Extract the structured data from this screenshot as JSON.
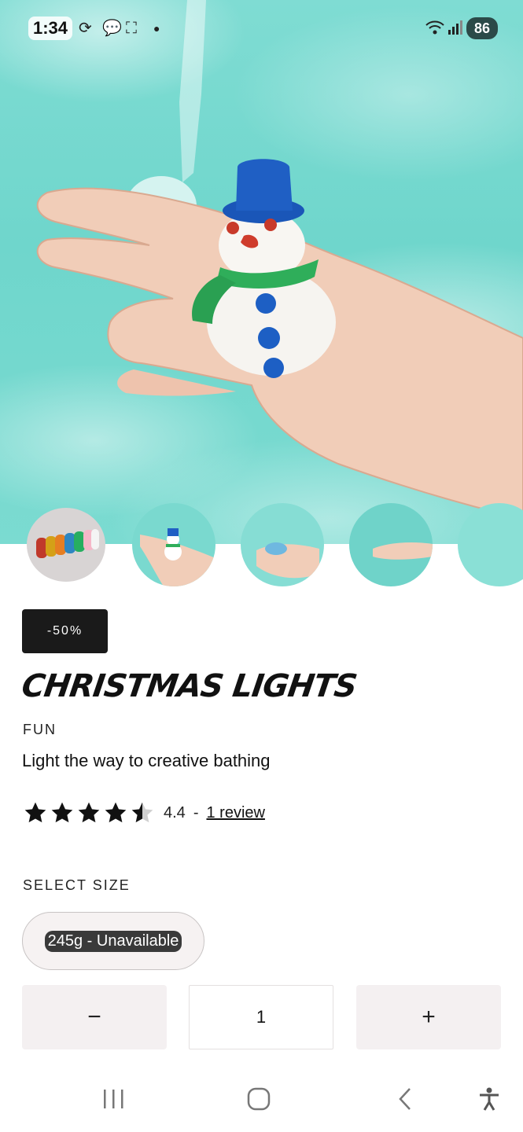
{
  "status_bar": {
    "time": "1:34",
    "battery": "86",
    "icons": [
      "sync-icon",
      "chat-icon",
      "screenshot-icon",
      "dot-icon",
      "wifi-icon",
      "signal-icon"
    ]
  },
  "hero": {
    "image": "snowman-bath-bomb-in-hand-over-bath-water"
  },
  "thumbnails": [
    {
      "name": "rainbow-soap-stack",
      "active": true
    },
    {
      "name": "snowman-in-hand",
      "active": false
    },
    {
      "name": "hands-with-foam",
      "active": false
    },
    {
      "name": "hand-in-water",
      "active": false
    },
    {
      "name": "bath-foam",
      "active": false
    }
  ],
  "product": {
    "discount": "-50%",
    "title": "CHRISTMAS LIGHTS",
    "category": "FUN",
    "tagline": "Light the way to creative bathing",
    "rating": 4.4,
    "rating_text": "4.4",
    "rating_separator": "-",
    "review_link": "1 review"
  },
  "size": {
    "label": "SELECT SIZE",
    "option": "245g - Unavailable"
  },
  "quantity": {
    "minus": "−",
    "value": "1",
    "plus": "+"
  },
  "nav_bar": {
    "icons": [
      "recent-apps-icon",
      "home-icon",
      "back-icon",
      "accessibility-icon"
    ]
  },
  "colors": {
    "water": "#6fd6cc",
    "badge": "#1a1a1a",
    "qty_button": "#f4f0f1"
  }
}
